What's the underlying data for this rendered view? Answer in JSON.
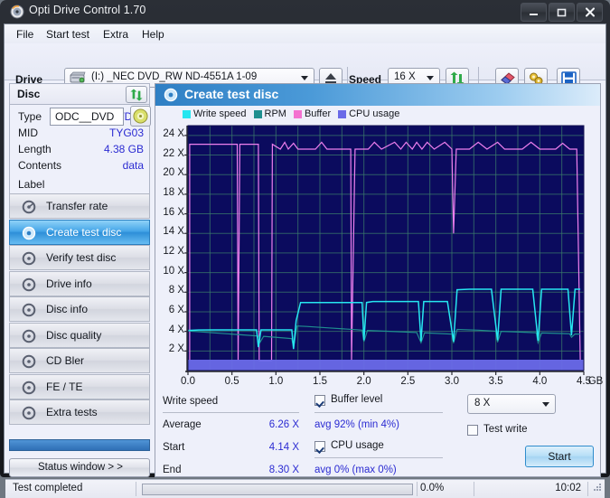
{
  "window": {
    "title": "Opti Drive Control 1.70",
    "icon": "disc-icon",
    "buttons": {
      "minimize": "–",
      "maximize": "□",
      "close": "✕"
    }
  },
  "menubar": {
    "items": [
      "File",
      "Start test",
      "Extra",
      "Help"
    ]
  },
  "toolbar": {
    "drive_label": "Drive",
    "drive_value": "(I:)  _NEC DVD_RW ND-4551A 1-09",
    "speed_label": "Speed",
    "speed_value": "16 X",
    "icons": [
      "eject-icon",
      "refresh-icon",
      "eraser-icon",
      "settings-icon",
      "save-icon"
    ]
  },
  "disc_panel": {
    "header": "Disc",
    "refresh_icon": "refresh-icon",
    "rows": [
      {
        "key": "Type",
        "value": "DVD-R"
      },
      {
        "key": "MID",
        "value": "TYG03"
      },
      {
        "key": "Length",
        "value": "4.38 GB"
      },
      {
        "key": "Contents",
        "value": "data"
      }
    ],
    "label_key": "Label",
    "label_value": "ODC__DVD",
    "label_icon": "disc-icon"
  },
  "nav": {
    "items": [
      {
        "label": "Transfer rate",
        "selected": false
      },
      {
        "label": "Create test disc",
        "selected": true
      },
      {
        "label": "Verify test disc",
        "selected": false
      },
      {
        "label": "Drive info",
        "selected": false
      },
      {
        "label": "Disc info",
        "selected": false
      },
      {
        "label": "Disc quality",
        "selected": false
      },
      {
        "label": "CD Bler",
        "selected": false
      },
      {
        "label": "FE / TE",
        "selected": false
      },
      {
        "label": "Extra tests",
        "selected": false
      }
    ],
    "status_window_button": "Status window > >"
  },
  "content": {
    "title": "Create test disc",
    "title_icon": "disc-icon"
  },
  "stats": {
    "write_speed_title": "Write speed",
    "rows": [
      {
        "key": "Average",
        "value": "6.26 X"
      },
      {
        "key": "Start",
        "value": "4.14 X"
      },
      {
        "key": "End",
        "value": "8.30 X"
      }
    ],
    "buffer_level_label": "Buffer level",
    "buffer_level_checked": true,
    "buffer_level_value": "avg 92% (min 4%)",
    "cpu_usage_label": "CPU usage",
    "cpu_usage_checked": true,
    "cpu_usage_value": "avg 0% (max 0%)",
    "write_speed_select": "8 X",
    "test_write_label": "Test write",
    "test_write_checked": false,
    "start_button": "Start"
  },
  "statusbar": {
    "message": "Test completed",
    "progress_percent": "0.0%",
    "progress_value": 0,
    "time": "10:02"
  },
  "colors": {
    "write_speed": "#26e6f0",
    "rpm": "#1f8f8f",
    "buffer": "#ee7fee",
    "cpu_usage": "#6a6ae8",
    "plot_bg": "#0b0b5e",
    "grid": "#3a7a6a",
    "accent": "#2f7fc4"
  },
  "chart_data": {
    "type": "line",
    "title": "Create test disc",
    "xlabel": "GB",
    "ylabel": "X",
    "xlim": [
      0.0,
      4.5
    ],
    "ylim": [
      0,
      25
    ],
    "xticks": [
      0.0,
      0.5,
      1.0,
      1.5,
      2.0,
      2.5,
      3.0,
      3.5,
      4.0,
      4.5
    ],
    "xtick_labels": [
      "0.0",
      "0.5",
      "1.0",
      "1.5",
      "2.0",
      "2.5",
      "3.0",
      "3.5",
      "4.0",
      "4.5"
    ],
    "x_axis_unit": "GB",
    "yticks": [
      2,
      4,
      6,
      8,
      10,
      12,
      14,
      16,
      18,
      20,
      22,
      24
    ],
    "ytick_labels": [
      "2 X",
      "4 X",
      "6 X",
      "8 X",
      "10 X",
      "12 X",
      "14 X",
      "16 X",
      "18 X",
      "20 X",
      "22 X",
      "24 X"
    ],
    "grid": true,
    "legend_position": "top",
    "legend": [
      "Write speed",
      "RPM",
      "Buffer",
      "CPU usage"
    ],
    "series": [
      {
        "name": "Write speed",
        "color": "#26e6f0",
        "points": [
          [
            0.0,
            4.1
          ],
          [
            0.12,
            4.14
          ],
          [
            0.3,
            4.15
          ],
          [
            0.55,
            4.15
          ],
          [
            0.7,
            4.15
          ],
          [
            0.78,
            4.15
          ],
          [
            0.8,
            2.4
          ],
          [
            0.83,
            4.15
          ],
          [
            1.0,
            4.15
          ],
          [
            1.18,
            4.15
          ],
          [
            1.2,
            2.2
          ],
          [
            1.23,
            5.1
          ],
          [
            1.28,
            6.95
          ],
          [
            1.32,
            6.95
          ],
          [
            1.6,
            6.95
          ],
          [
            1.85,
            6.95
          ],
          [
            1.98,
            6.95
          ],
          [
            2.0,
            3.1
          ],
          [
            2.03,
            6.95
          ],
          [
            2.1,
            7.05
          ],
          [
            2.4,
            7.05
          ],
          [
            2.62,
            7.05
          ],
          [
            2.65,
            3.0
          ],
          [
            2.68,
            7.05
          ],
          [
            2.78,
            7.05
          ],
          [
            2.95,
            7.05
          ],
          [
            3.02,
            2.95
          ],
          [
            3.06,
            8.25
          ],
          [
            3.2,
            8.3
          ],
          [
            3.45,
            8.3
          ],
          [
            3.52,
            3.1
          ],
          [
            3.56,
            8.3
          ],
          [
            3.7,
            8.3
          ],
          [
            3.92,
            8.3
          ],
          [
            3.98,
            3.05
          ],
          [
            4.02,
            8.3
          ],
          [
            4.2,
            8.3
          ],
          [
            4.32,
            8.3
          ],
          [
            4.36,
            3.6
          ],
          [
            4.4,
            8.3
          ],
          [
            4.46,
            8.3
          ]
        ]
      },
      {
        "name": "RPM",
        "color": "#1f8f8f",
        "points": [
          [
            0.0,
            4.05
          ],
          [
            0.3,
            3.85
          ],
          [
            0.6,
            3.65
          ],
          [
            0.8,
            3.52
          ],
          [
            0.82,
            2.9
          ],
          [
            0.86,
            3.5
          ],
          [
            1.1,
            3.32
          ],
          [
            1.18,
            3.26
          ],
          [
            1.2,
            2.35
          ],
          [
            1.24,
            4.55
          ],
          [
            1.35,
            4.5
          ],
          [
            1.6,
            4.35
          ],
          [
            1.9,
            4.18
          ],
          [
            1.98,
            4.12
          ],
          [
            2.0,
            2.95
          ],
          [
            2.04,
            4.1
          ],
          [
            2.3,
            4.0
          ],
          [
            2.6,
            3.88
          ],
          [
            2.65,
            2.85
          ],
          [
            2.69,
            3.85
          ],
          [
            3.0,
            3.72
          ],
          [
            3.02,
            2.8
          ],
          [
            3.06,
            4.2
          ],
          [
            3.3,
            4.12
          ],
          [
            3.5,
            4.02
          ],
          [
            3.52,
            2.9
          ],
          [
            3.56,
            4.0
          ],
          [
            3.8,
            3.92
          ],
          [
            3.96,
            3.86
          ],
          [
            3.98,
            2.85
          ],
          [
            4.02,
            3.84
          ],
          [
            4.25,
            3.78
          ],
          [
            4.34,
            3.75
          ],
          [
            4.36,
            3.4
          ],
          [
            4.4,
            3.74
          ],
          [
            4.46,
            3.72
          ]
        ]
      },
      {
        "name": "Buffer",
        "color": "#ee7fee",
        "points": [
          [
            0.02,
            1.0
          ],
          [
            0.02,
            23.1
          ],
          [
            0.4,
            23.1
          ],
          [
            0.56,
            23.1
          ],
          [
            0.57,
            1.0
          ],
          [
            0.58,
            12.5
          ],
          [
            0.59,
            23.1
          ],
          [
            0.8,
            23.1
          ],
          [
            0.81,
            1.0
          ],
          [
            0.95,
            1.0
          ],
          [
            0.96,
            23.1
          ],
          [
            1.05,
            22.6
          ],
          [
            1.1,
            23.3
          ],
          [
            1.14,
            22.6
          ],
          [
            1.2,
            23.2
          ],
          [
            1.25,
            22.6
          ],
          [
            1.45,
            22.6
          ],
          [
            1.52,
            23.3
          ],
          [
            1.58,
            22.6
          ],
          [
            1.85,
            22.6
          ],
          [
            1.86,
            1.0
          ],
          [
            1.9,
            22.6
          ],
          [
            2.05,
            22.6
          ],
          [
            2.12,
            23.3
          ],
          [
            2.2,
            22.6
          ],
          [
            2.35,
            23.3
          ],
          [
            2.42,
            22.6
          ],
          [
            2.48,
            23.3
          ],
          [
            2.55,
            22.6
          ],
          [
            2.6,
            23.3
          ],
          [
            2.66,
            22.6
          ],
          [
            2.72,
            23.3
          ],
          [
            2.8,
            22.6
          ],
          [
            2.92,
            23.3
          ],
          [
            3.0,
            22.6
          ],
          [
            3.02,
            14.0
          ],
          [
            3.05,
            22.6
          ],
          [
            3.2,
            22.6
          ],
          [
            3.3,
            23.3
          ],
          [
            3.4,
            22.6
          ],
          [
            3.52,
            23.3
          ],
          [
            3.6,
            22.6
          ],
          [
            3.8,
            22.6
          ],
          [
            3.9,
            23.3
          ],
          [
            4.0,
            22.6
          ],
          [
            4.18,
            22.6
          ],
          [
            4.26,
            23.2
          ],
          [
            4.34,
            22.6
          ],
          [
            4.42,
            22.6
          ],
          [
            4.46,
            1.0
          ]
        ]
      },
      {
        "name": "CPU usage",
        "color": "#6a6ae8",
        "constant": 0.4,
        "note": "Flat band along bottom axis, avg 0% (max 0%)"
      }
    ],
    "summary": {
      "average_write_speed": "6.26 X",
      "start_write_speed": "4.14 X",
      "end_write_speed": "8.30 X",
      "buffer": "avg 92% (min 4%)",
      "cpu": "avg 0% (max 0%)"
    }
  }
}
